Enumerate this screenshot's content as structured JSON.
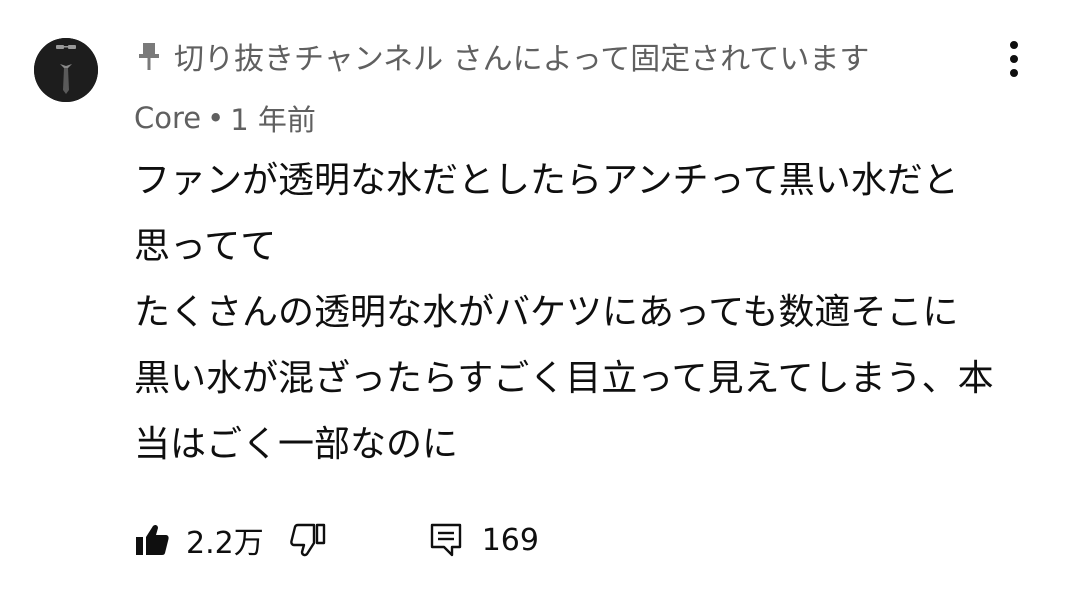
{
  "comment": {
    "pinned_text": "切り抜きチャンネル さんによって固定されています",
    "author": "Core",
    "separator": "•",
    "time": "1 年前",
    "text": "ファンが透明な水だとしたらアンチって黒い水だと思ってて\nたくさんの透明な水がバケツにあっても数適そこに黒い水が混ざったらすごく目立って見えてしまう、本当はごく一部なのに",
    "likes": "2.2万",
    "replies": "169"
  },
  "icons": {
    "avatar": "avatar",
    "pin": "pin-icon",
    "more": "more-vertical-icon",
    "like": "thumbs-up-filled-icon",
    "dislike": "thumbs-down-outline-icon",
    "reply": "comment-icon"
  },
  "colors": {
    "text_primary": "#0f0f0f",
    "text_secondary": "#606060",
    "avatar_bg": "#1d1d1d"
  }
}
